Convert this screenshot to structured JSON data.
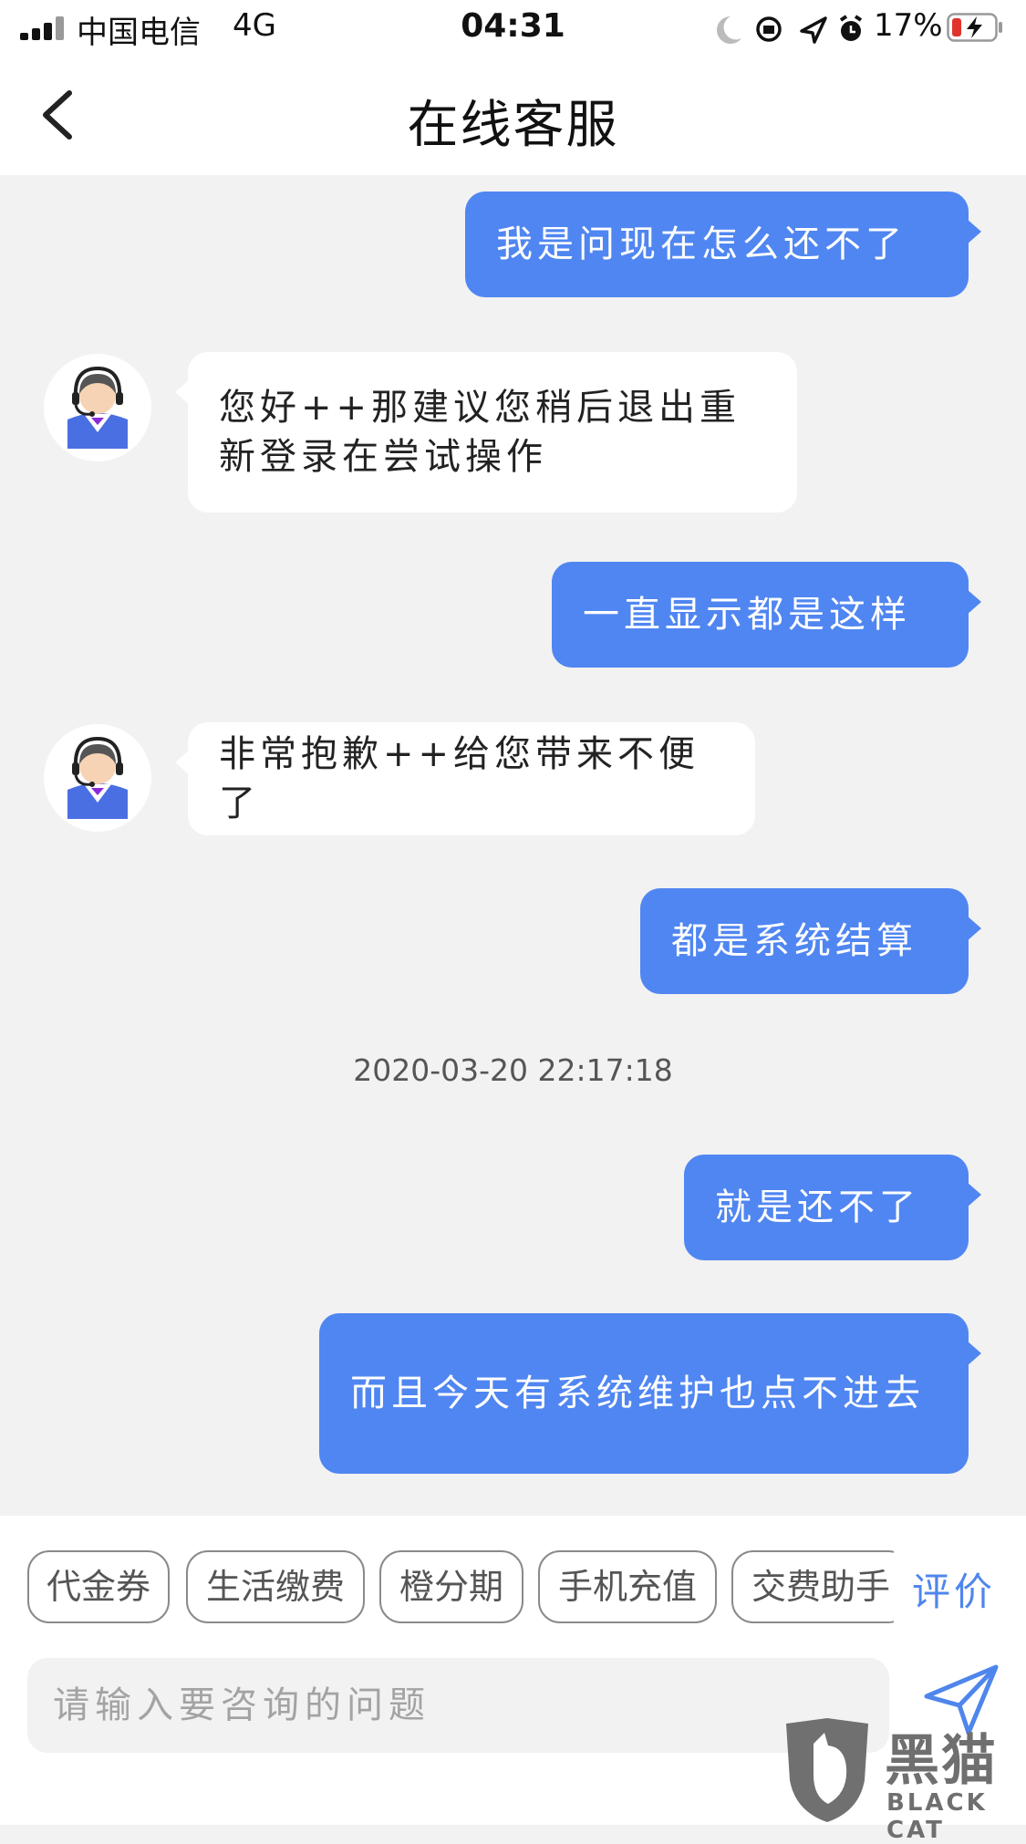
{
  "status_bar": {
    "carrier": "中国电信",
    "network": "4G",
    "time": "04:31",
    "battery": "17%"
  },
  "nav": {
    "title": "在线客服",
    "back_icon": "chevron-left-icon"
  },
  "messages": [
    {
      "from": "user",
      "text": "我是问现在怎么还不了"
    },
    {
      "from": "agent",
      "text": "您好++那建议您稍后退出重新登录在尝试操作"
    },
    {
      "from": "user",
      "text": "一直显示都是这样"
    },
    {
      "from": "agent",
      "text": "非常抱歉++给您带来不便了"
    },
    {
      "from": "user",
      "text": "都是系统结算"
    },
    {
      "from": "user",
      "text": "就是还不了"
    },
    {
      "from": "user",
      "text": "而且今天有系统维护也点不进去"
    }
  ],
  "timestamp": "2020-03-20 22:17:18",
  "quick_actions": [
    "代金券",
    "生活缴费",
    "橙分期",
    "手机充值",
    "交费助手"
  ],
  "rate_label": "评价",
  "input": {
    "placeholder": "请输入要咨询的问题",
    "value": ""
  },
  "send_icon": "send-icon",
  "watermark": {
    "cn": "黑猫",
    "en": "BLACK CAT"
  },
  "colors": {
    "user_bubble": "#5086f1",
    "agent_bubble": "#ffffff",
    "background": "#f2f2f2",
    "accent": "#4f86ec"
  }
}
